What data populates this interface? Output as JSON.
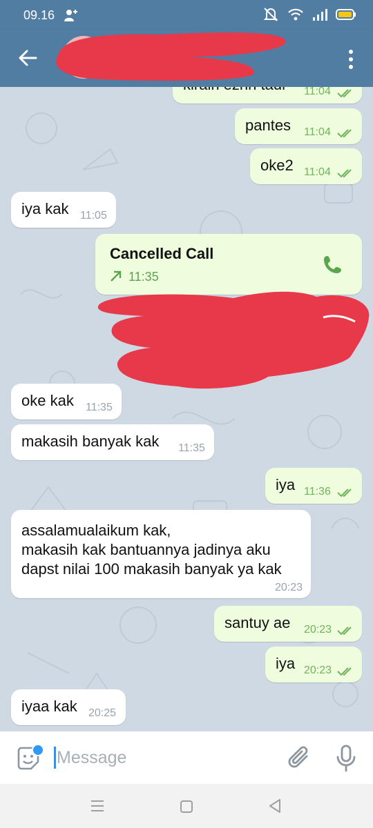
{
  "status_bar": {
    "time": "09.16",
    "icons": [
      "add-user-icon",
      "mute-icon",
      "wifi-icon",
      "signal-icon",
      "battery-icon"
    ]
  },
  "header": {
    "contact_name": "",
    "icons": [
      "back-arrow-icon",
      "avatar",
      "more-vert-icon"
    ]
  },
  "messages": [
    {
      "dir": "out",
      "text": "kirain ezhh tadi",
      "time": "11:04",
      "read": true
    },
    {
      "dir": "out",
      "text": "pantes",
      "time": "11:04",
      "read": true
    },
    {
      "dir": "out",
      "text": "oke2",
      "time": "11:04",
      "read": true
    },
    {
      "dir": "in",
      "text": "iya kak",
      "time": "11:05"
    },
    {
      "dir": "out",
      "type": "call",
      "text": "Cancelled Call",
      "time": "11:35"
    },
    {
      "dir": "in",
      "text": "oke kak",
      "time": "11:35"
    },
    {
      "dir": "in",
      "text": "makasih banyak kak",
      "time": "11:35"
    },
    {
      "dir": "out",
      "text": "iya",
      "time": "11:36",
      "read": true
    },
    {
      "dir": "in",
      "lines": [
        "assalamualaikum kak,",
        "makasih kak bantuannya jadinya aku",
        "dapst nilai 100 makasih banyak ya kak"
      ],
      "time": "20:23"
    },
    {
      "dir": "out",
      "text": "santuy ae",
      "time": "20:23",
      "read": true
    },
    {
      "dir": "out",
      "text": "iya",
      "time": "20:23",
      "read": true
    },
    {
      "dir": "in",
      "text": "iyaa kak",
      "time": "20:25"
    }
  ],
  "input": {
    "placeholder": "Message",
    "value": ""
  },
  "colors": {
    "header": "#527da3",
    "chat_background": "#cfd9e3",
    "incoming_bubble": "#ffffff",
    "outgoing_bubble": "#effdde",
    "outgoing_time": "#6fb35a",
    "call_green": "#5aa54e",
    "redaction": "#e8394a",
    "accent_blue": "#2e9af3"
  },
  "nav_bar": {
    "icons": [
      "recents-icon",
      "home-icon",
      "back-icon"
    ]
  }
}
